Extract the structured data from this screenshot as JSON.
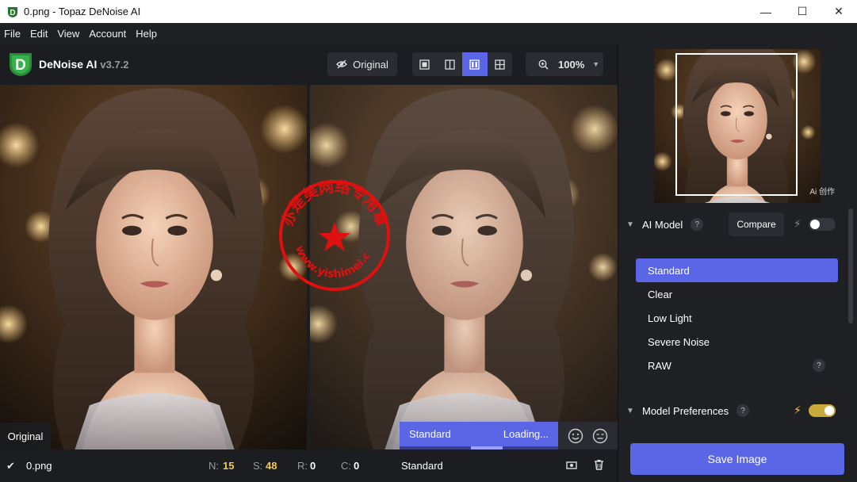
{
  "window": {
    "title": "0.png - Topaz DeNoise AI",
    "minimize": "—",
    "maximize": "☐",
    "close": "✕"
  },
  "menu": [
    "File",
    "Edit",
    "View",
    "Account",
    "Help"
  ],
  "toolbar": {
    "app_name": "DeNoise AI",
    "version": "v3.7.2",
    "original_label": "Original",
    "zoom": "100%",
    "active_view": "side-by-side"
  },
  "image": {
    "original_label": "Original",
    "processing_model": "Standard",
    "processing_status": "Loading...",
    "watermark_url": "www.yishimei.cn",
    "watermark_text": "亦是美网络专用章"
  },
  "status": {
    "filename": "0.png",
    "n_label": "N:",
    "n_value": "15",
    "s_label": "S:",
    "s_value": "48",
    "r_label": "R:",
    "r_value": "0",
    "c_label": "C:",
    "c_value": "0",
    "model": "Standard"
  },
  "panel": {
    "navigator_tag": "Ai 创作",
    "ai_model": {
      "title": "AI Model",
      "compare_label": "Compare",
      "auto_enabled": false,
      "models": [
        "Standard",
        "Clear",
        "Low Light",
        "Severe Noise",
        "RAW"
      ],
      "selected": "Standard"
    },
    "model_preferences": {
      "title": "Model Preferences",
      "enabled": true
    },
    "save_label": "Save Image"
  },
  "colors": {
    "accent": "#5b66e6",
    "toggle_on": "#c8a93a",
    "stat_value": "#f2c84b"
  }
}
